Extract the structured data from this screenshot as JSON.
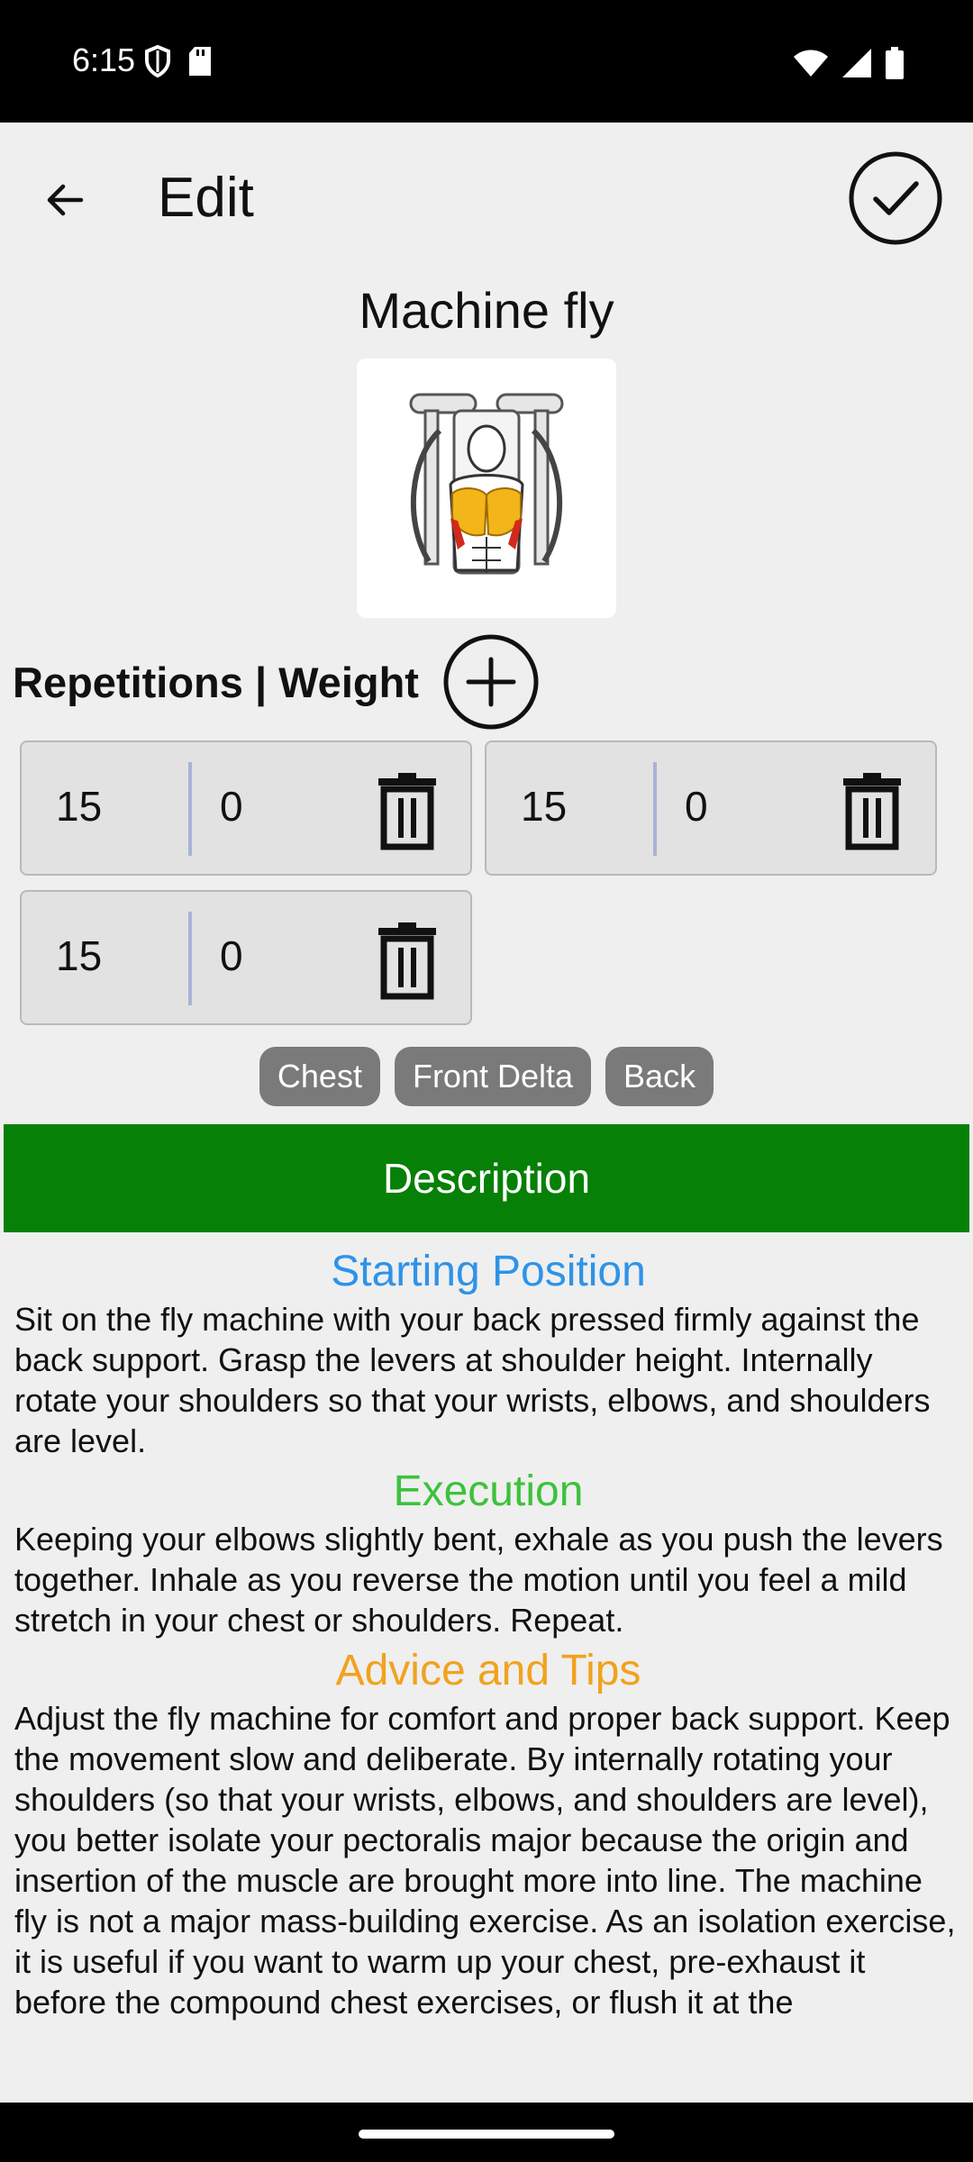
{
  "status_bar": {
    "time": "6:15",
    "icons": [
      "shield-icon",
      "sd-card-icon",
      "wifi-icon",
      "signal-icon",
      "battery-icon"
    ]
  },
  "app_bar": {
    "title": "Edit",
    "back_icon": "arrow-back-icon",
    "confirm_icon": "check-circle-icon"
  },
  "exercise": {
    "name": "Machine fly",
    "image": "machine-fly-illustration"
  },
  "sets_header": "Repetitions | Weight",
  "sets": [
    {
      "reps": "15",
      "weight": "0"
    },
    {
      "reps": "15",
      "weight": "0"
    },
    {
      "reps": "15",
      "weight": "0"
    }
  ],
  "muscles": [
    "Chest",
    "Front Delta",
    "Back"
  ],
  "description": {
    "banner": "Description",
    "starting_position_title": "Starting Position",
    "starting_position_text": "Sit on the fly machine with your back pressed firmly against the back support. Grasp the levers at shoulder height. Internally rotate your shoulders so that your wrists, elbows, and shoulders are level.",
    "execution_title": "Execution",
    "execution_text": "Keeping your elbows slightly bent, exhale as you push the levers together. Inhale as you reverse the motion until you feel a mild stretch in your chest or shoulders. Repeat.",
    "tips_title": "Advice and Tips",
    "tips_text": "Adjust the fly machine for comfort and proper back support. Keep the movement slow and deliberate. By internally rotating your shoulders (so that your wrists, elbows, and shoulders are level), you better isolate your pectoralis major because the origin and insertion of the muscle are brought more into line. The machine fly is not a major mass-building exercise. As an isolation exercise, it is useful if you want to warm up your chest, pre-exhaust it before the compound chest exercises, or flush it at the"
  },
  "colors": {
    "starting_position": "#2e93e8",
    "execution": "#3cc23c",
    "tips": "#f1a21e",
    "description_banner": "#068006",
    "chip": "#7a7a7a"
  }
}
